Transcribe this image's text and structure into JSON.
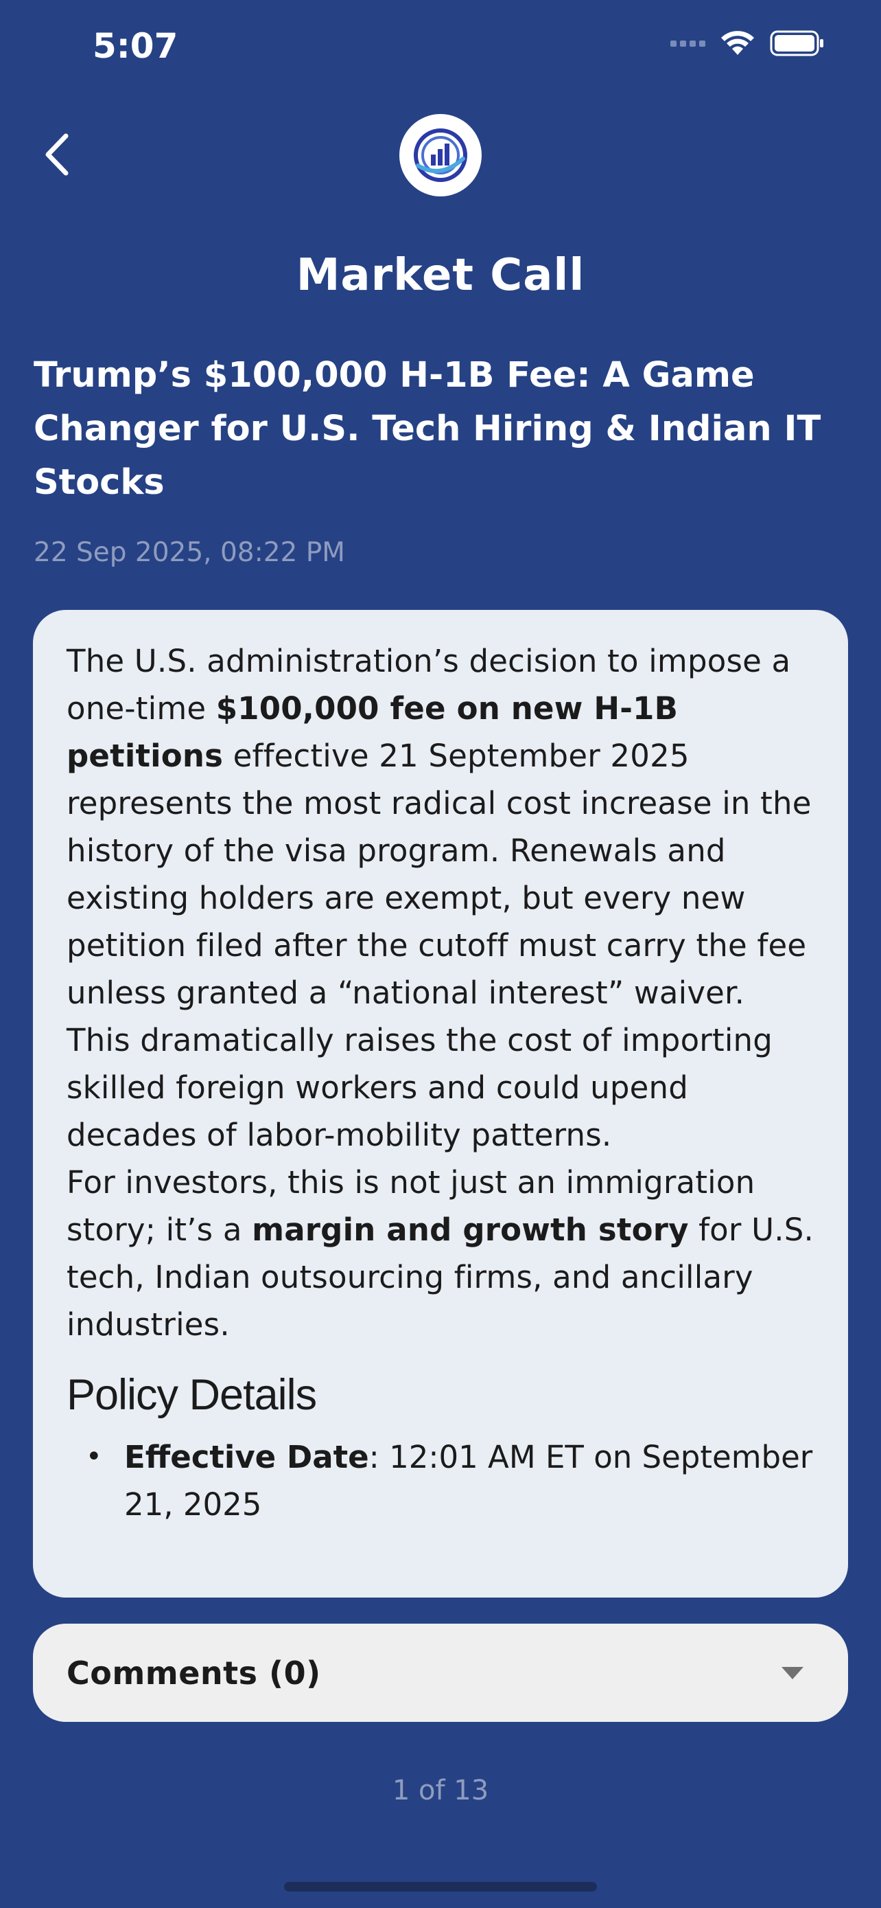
{
  "status_bar": {
    "time": "5:07"
  },
  "header": {
    "title": "Market Call"
  },
  "article": {
    "title": "Trump’s $100,000 H-1B Fee: A Game Changer for U.S. Tech Hiring & Indian IT Stocks",
    "date": "22 Sep 2025, 08:22 PM",
    "p1_a": "The U.S. administration’s decision to impose a one-time ",
    "p1_b": "$100,000 fee on new H-1B petitions",
    "p1_c": " effective 21 September 2025 represents the most radical cost increase in the history of the visa program. Renewals and existing holders are exempt, but every new petition filed after the cutoff must carry the fee unless granted a “national interest” waiver. This dramatically raises the cost of importing skilled foreign workers and could upend decades of labor-mobility patterns.",
    "p2_a": "For investors, this is not just an immigration story; it’s a ",
    "p2_b": "margin and growth story",
    "p2_c": " for U.S. tech, Indian outsourcing firms, and ancillary industries.",
    "section_heading": "Policy Details",
    "bullet_label": "Effective Date",
    "bullet_text": ": 12:01 AM ET on September 21, 2025",
    "bullet_glyph": "•"
  },
  "comments": {
    "label": "Comments (0)"
  },
  "pager": {
    "text": "1 of 13"
  },
  "colors": {
    "background": "#264285",
    "card": "#e9edf4",
    "comments_bg": "#efefef",
    "muted_text": "#8f9cbf"
  },
  "icons": {
    "back": "chevron-left-icon",
    "logo": "app-logo-icon",
    "wifi": "wifi-icon",
    "battery": "battery-icon",
    "caret": "caret-down-icon"
  }
}
